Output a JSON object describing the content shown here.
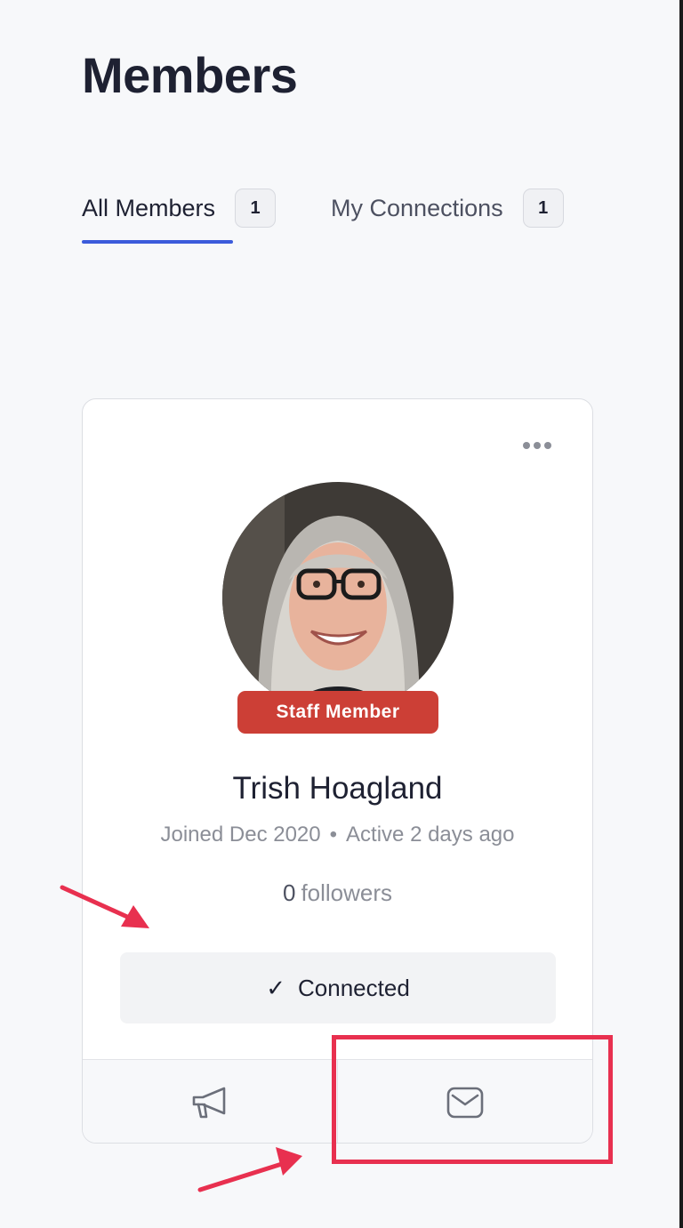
{
  "page": {
    "title": "Members"
  },
  "tabs": [
    {
      "label": "All Members",
      "count": "1",
      "active": true
    },
    {
      "label": "My Connections",
      "count": "1",
      "active": false
    }
  ],
  "member_card": {
    "badge": "Staff Member",
    "name": "Trish Hoagland",
    "joined": "Joined Dec 2020",
    "separator": "•",
    "activity": "Active 2 days ago",
    "followers_count": "0",
    "followers_label": "followers",
    "connect_button": {
      "check": "✓",
      "label": "Connected"
    },
    "footer_icons": [
      "megaphone-icon",
      "mail-icon"
    ]
  },
  "colors": {
    "accent": "#3b5bdb",
    "badge": "#cc3f36",
    "annotation": "#e8304f"
  }
}
